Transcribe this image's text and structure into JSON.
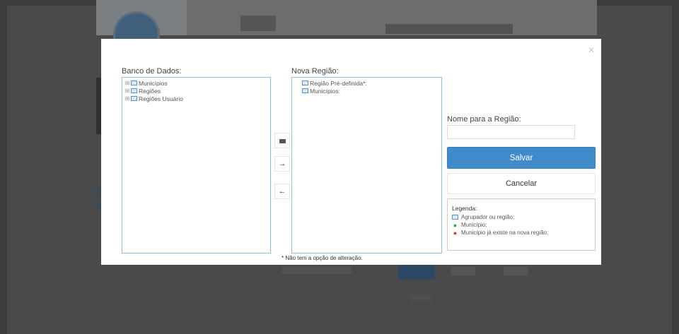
{
  "modal": {
    "close_label": "×",
    "database_panel": {
      "label": "Banco de Dados:",
      "items": [
        {
          "expander": "⊞",
          "label": "Municípios"
        },
        {
          "expander": "⊞",
          "label": "Regiões"
        },
        {
          "expander": "⊞",
          "label": "Regiões Usuário"
        }
      ]
    },
    "new_region_panel": {
      "label": "Nova Região:",
      "items": [
        {
          "label": "Região Pré-definida*:"
        },
        {
          "label": "Municípios:"
        }
      ]
    },
    "transfer_buttons": {
      "add_group": "",
      "add": "→",
      "remove": "←"
    },
    "note": "* Não tem a opção de alteração.",
    "name_label": "Nome para a Região:",
    "name_value": "",
    "save_label": "Salvar",
    "cancel_label": "Cancelar",
    "legend": {
      "title": "Legenda:",
      "items": [
        {
          "icon": "folder-icon",
          "label": "Agrupador ou região;"
        },
        {
          "icon": "pin-green-icon",
          "color": "#3aa335",
          "label": "Município;"
        },
        {
          "icon": "pin-red-icon",
          "color": "#d9342b",
          "label": "Município já existe na nova região;"
        }
      ]
    }
  },
  "colors": {
    "primary": "#428bca",
    "tree_border": "#8fc3e0",
    "overlay": "#3c3c3c"
  }
}
